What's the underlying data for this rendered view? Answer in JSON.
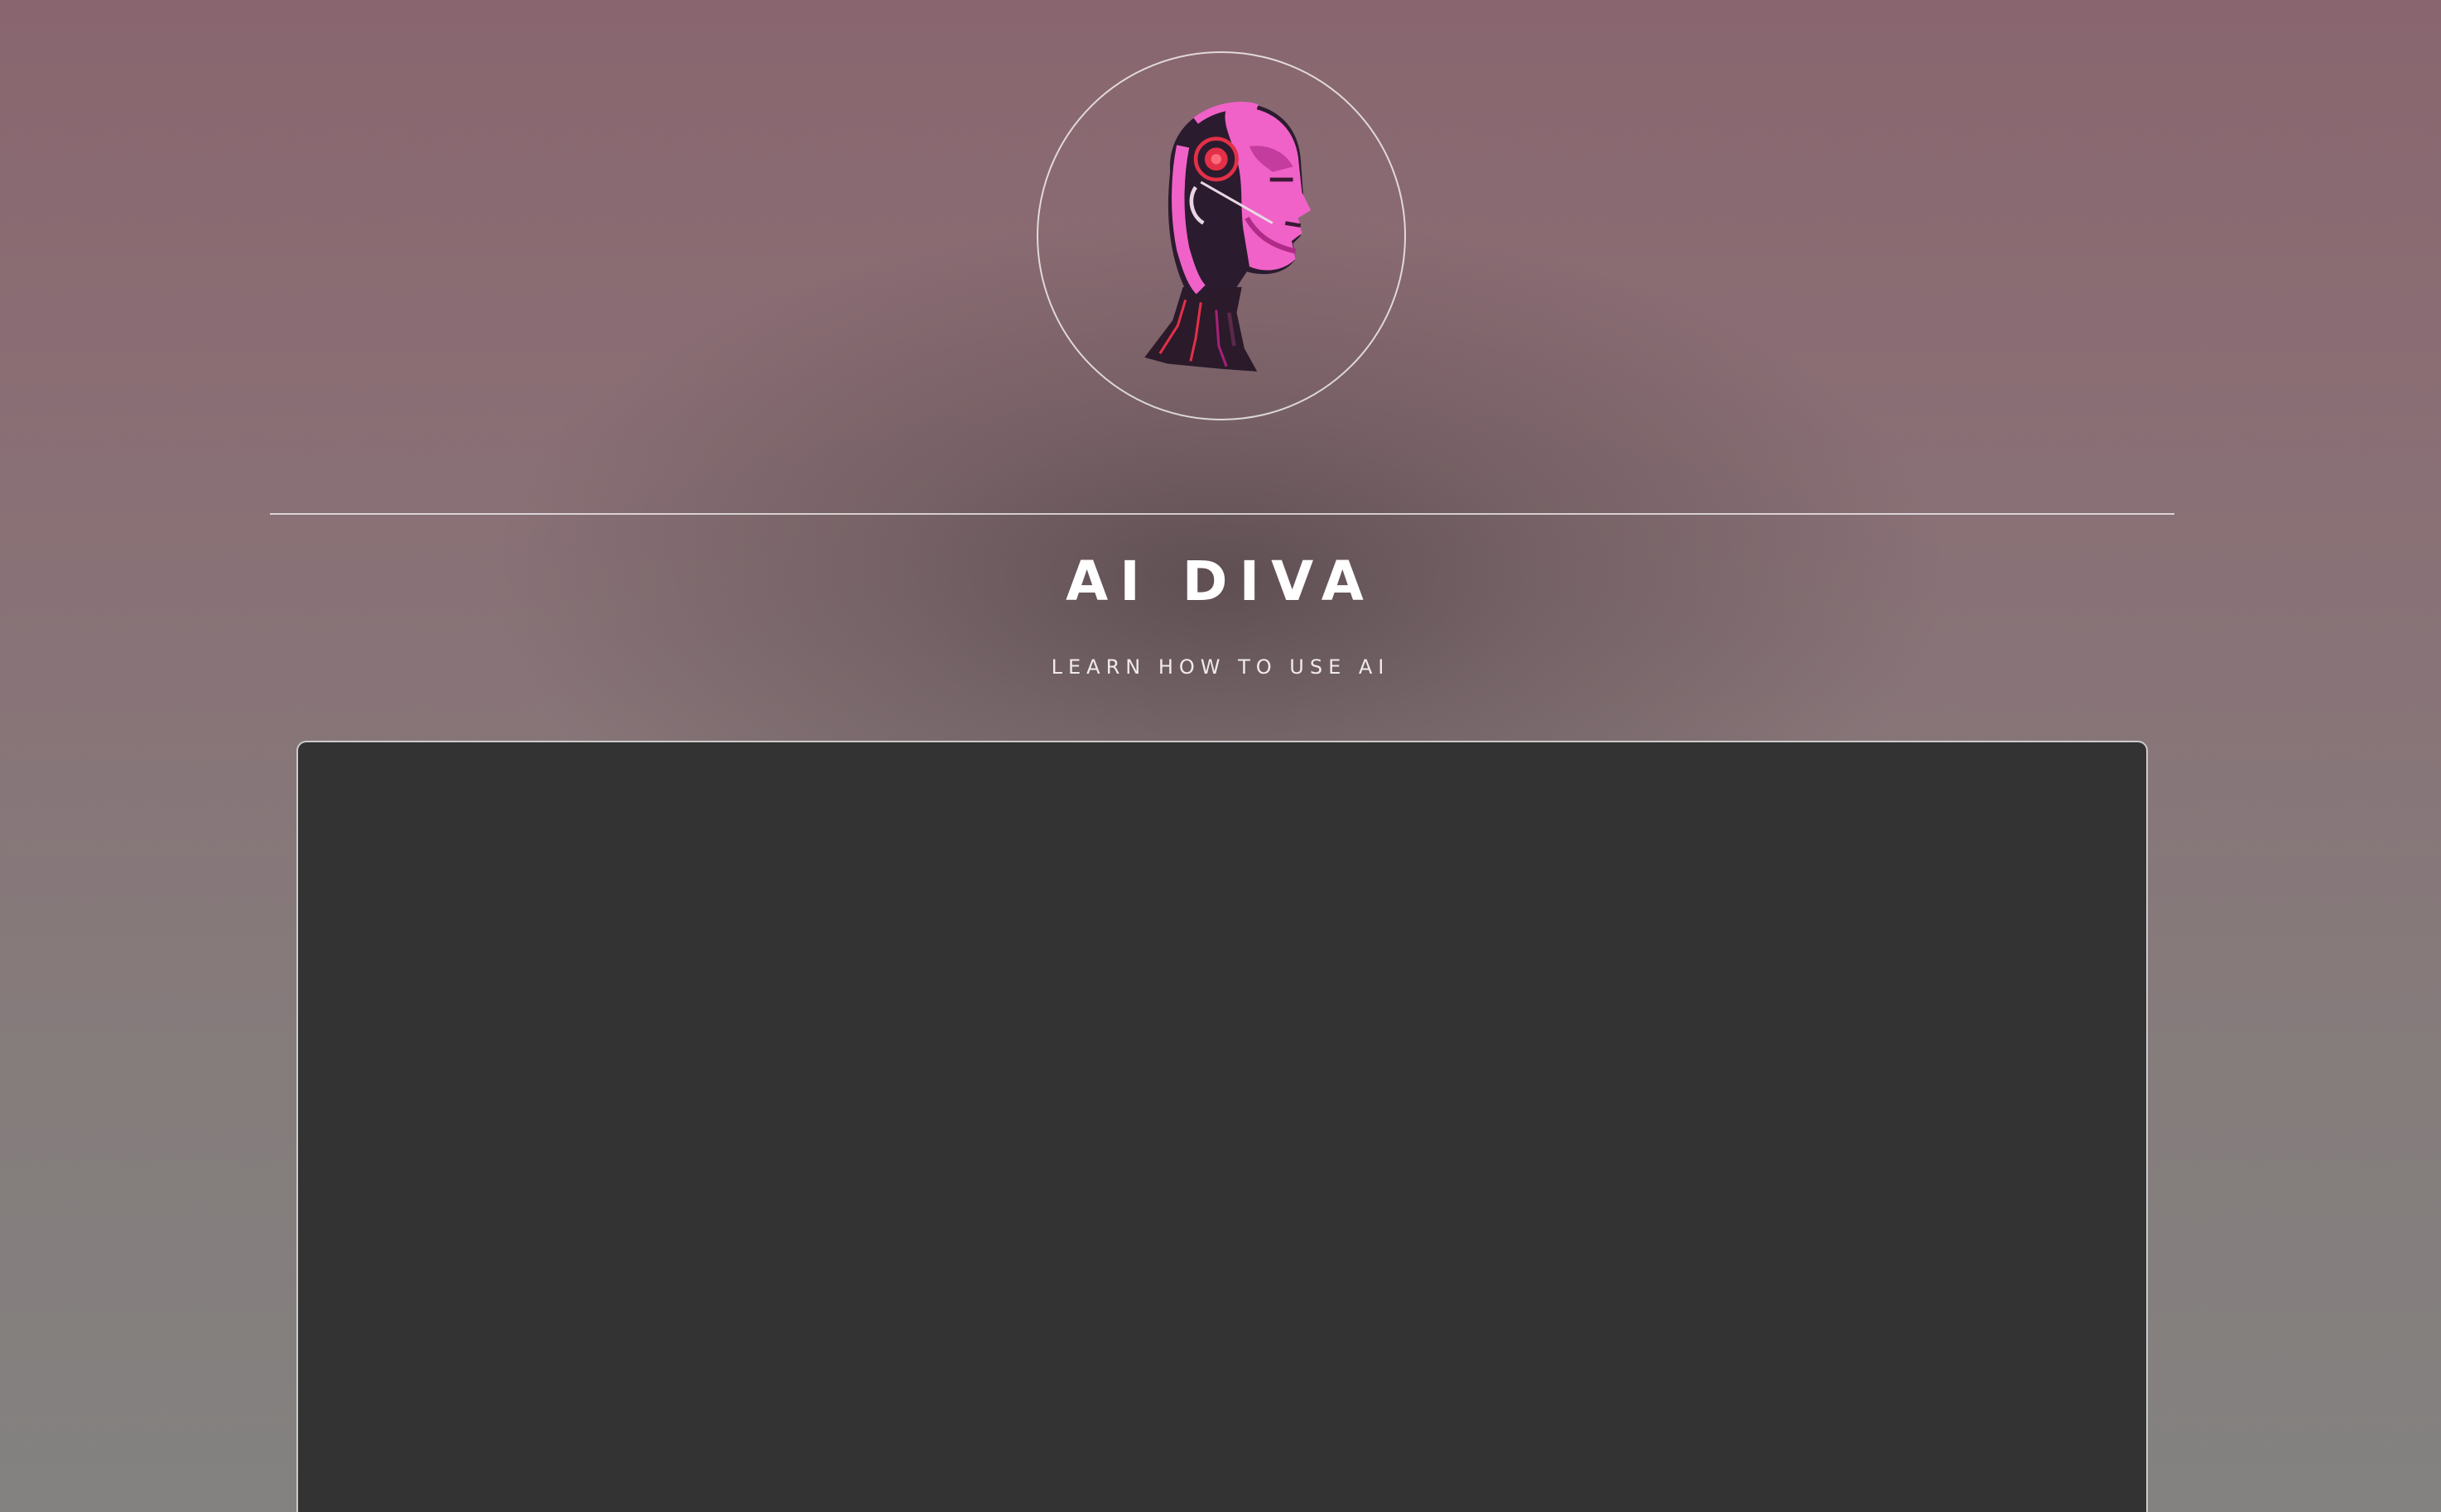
{
  "header": {
    "logo_icon": "robot-woman-head-icon",
    "title": "AI DIVA",
    "tagline": "LEARN HOW TO USE AI"
  },
  "colors": {
    "background_top": "#89666f",
    "background_bottom": "#838280",
    "panel": "#333333",
    "accent_pink": "#f062c8",
    "accent_red": "#e23048",
    "text": "#ffffff"
  },
  "main": {
    "panel": "embedded-content-panel"
  }
}
